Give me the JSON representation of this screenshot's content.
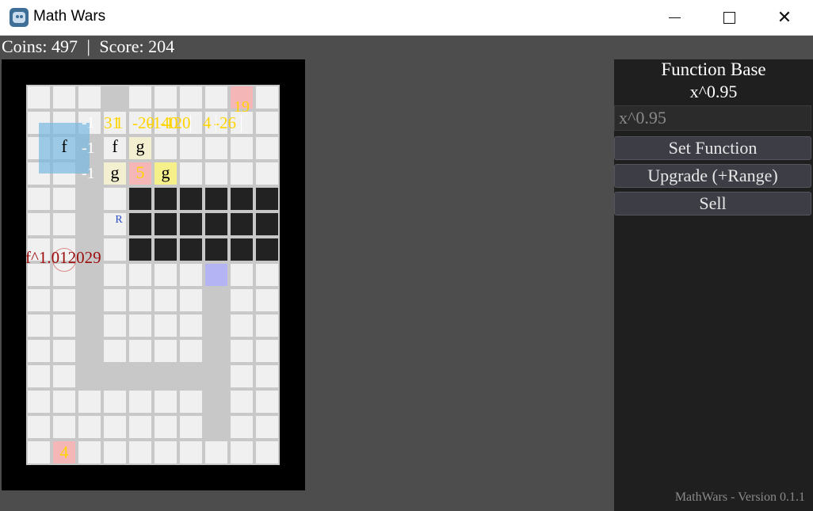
{
  "window": {
    "title": "Math Wars",
    "minimize": "—",
    "maximize": "☐",
    "close": "✕"
  },
  "hud": {
    "coins_label": "Coins: 497",
    "separator": "|",
    "score_label": "Score: 204"
  },
  "board": {
    "range_tower_label": "f",
    "towers": [
      {
        "label": "f"
      },
      {
        "label": "g"
      },
      {
        "label": "g"
      },
      {
        "label": "5"
      },
      {
        "label": "g"
      },
      {
        "label": "4"
      },
      {
        "label": "19"
      }
    ],
    "neg_labels": [
      "-1",
      "-1",
      "-1"
    ],
    "yellow_texts": [
      "31",
      "1",
      "-20",
      "-140",
      "-120",
      "4",
      "-26"
    ],
    "enemy_text": "f^1.012029",
    "marker_text": "R",
    "colors": {
      "path": "#c8c8c8",
      "cell": "#f0f0f0",
      "wall": "#222222",
      "range": "#78b9e1",
      "enemy": "#9b0d0d"
    }
  },
  "panel": {
    "title": "Function Base",
    "current_function": "x^0.95",
    "input_value": "x^0.95",
    "input_placeholder": "x^0.95",
    "set_button": "Set Function",
    "upgrade_button": "Upgrade (+Range)",
    "sell_button": "Sell",
    "version": "MathWars - Version 0.1.1"
  },
  "icons": {
    "app": "godot-icon",
    "minimize": "minimize-icon",
    "maximize": "maximize-icon",
    "close": "close-icon"
  }
}
